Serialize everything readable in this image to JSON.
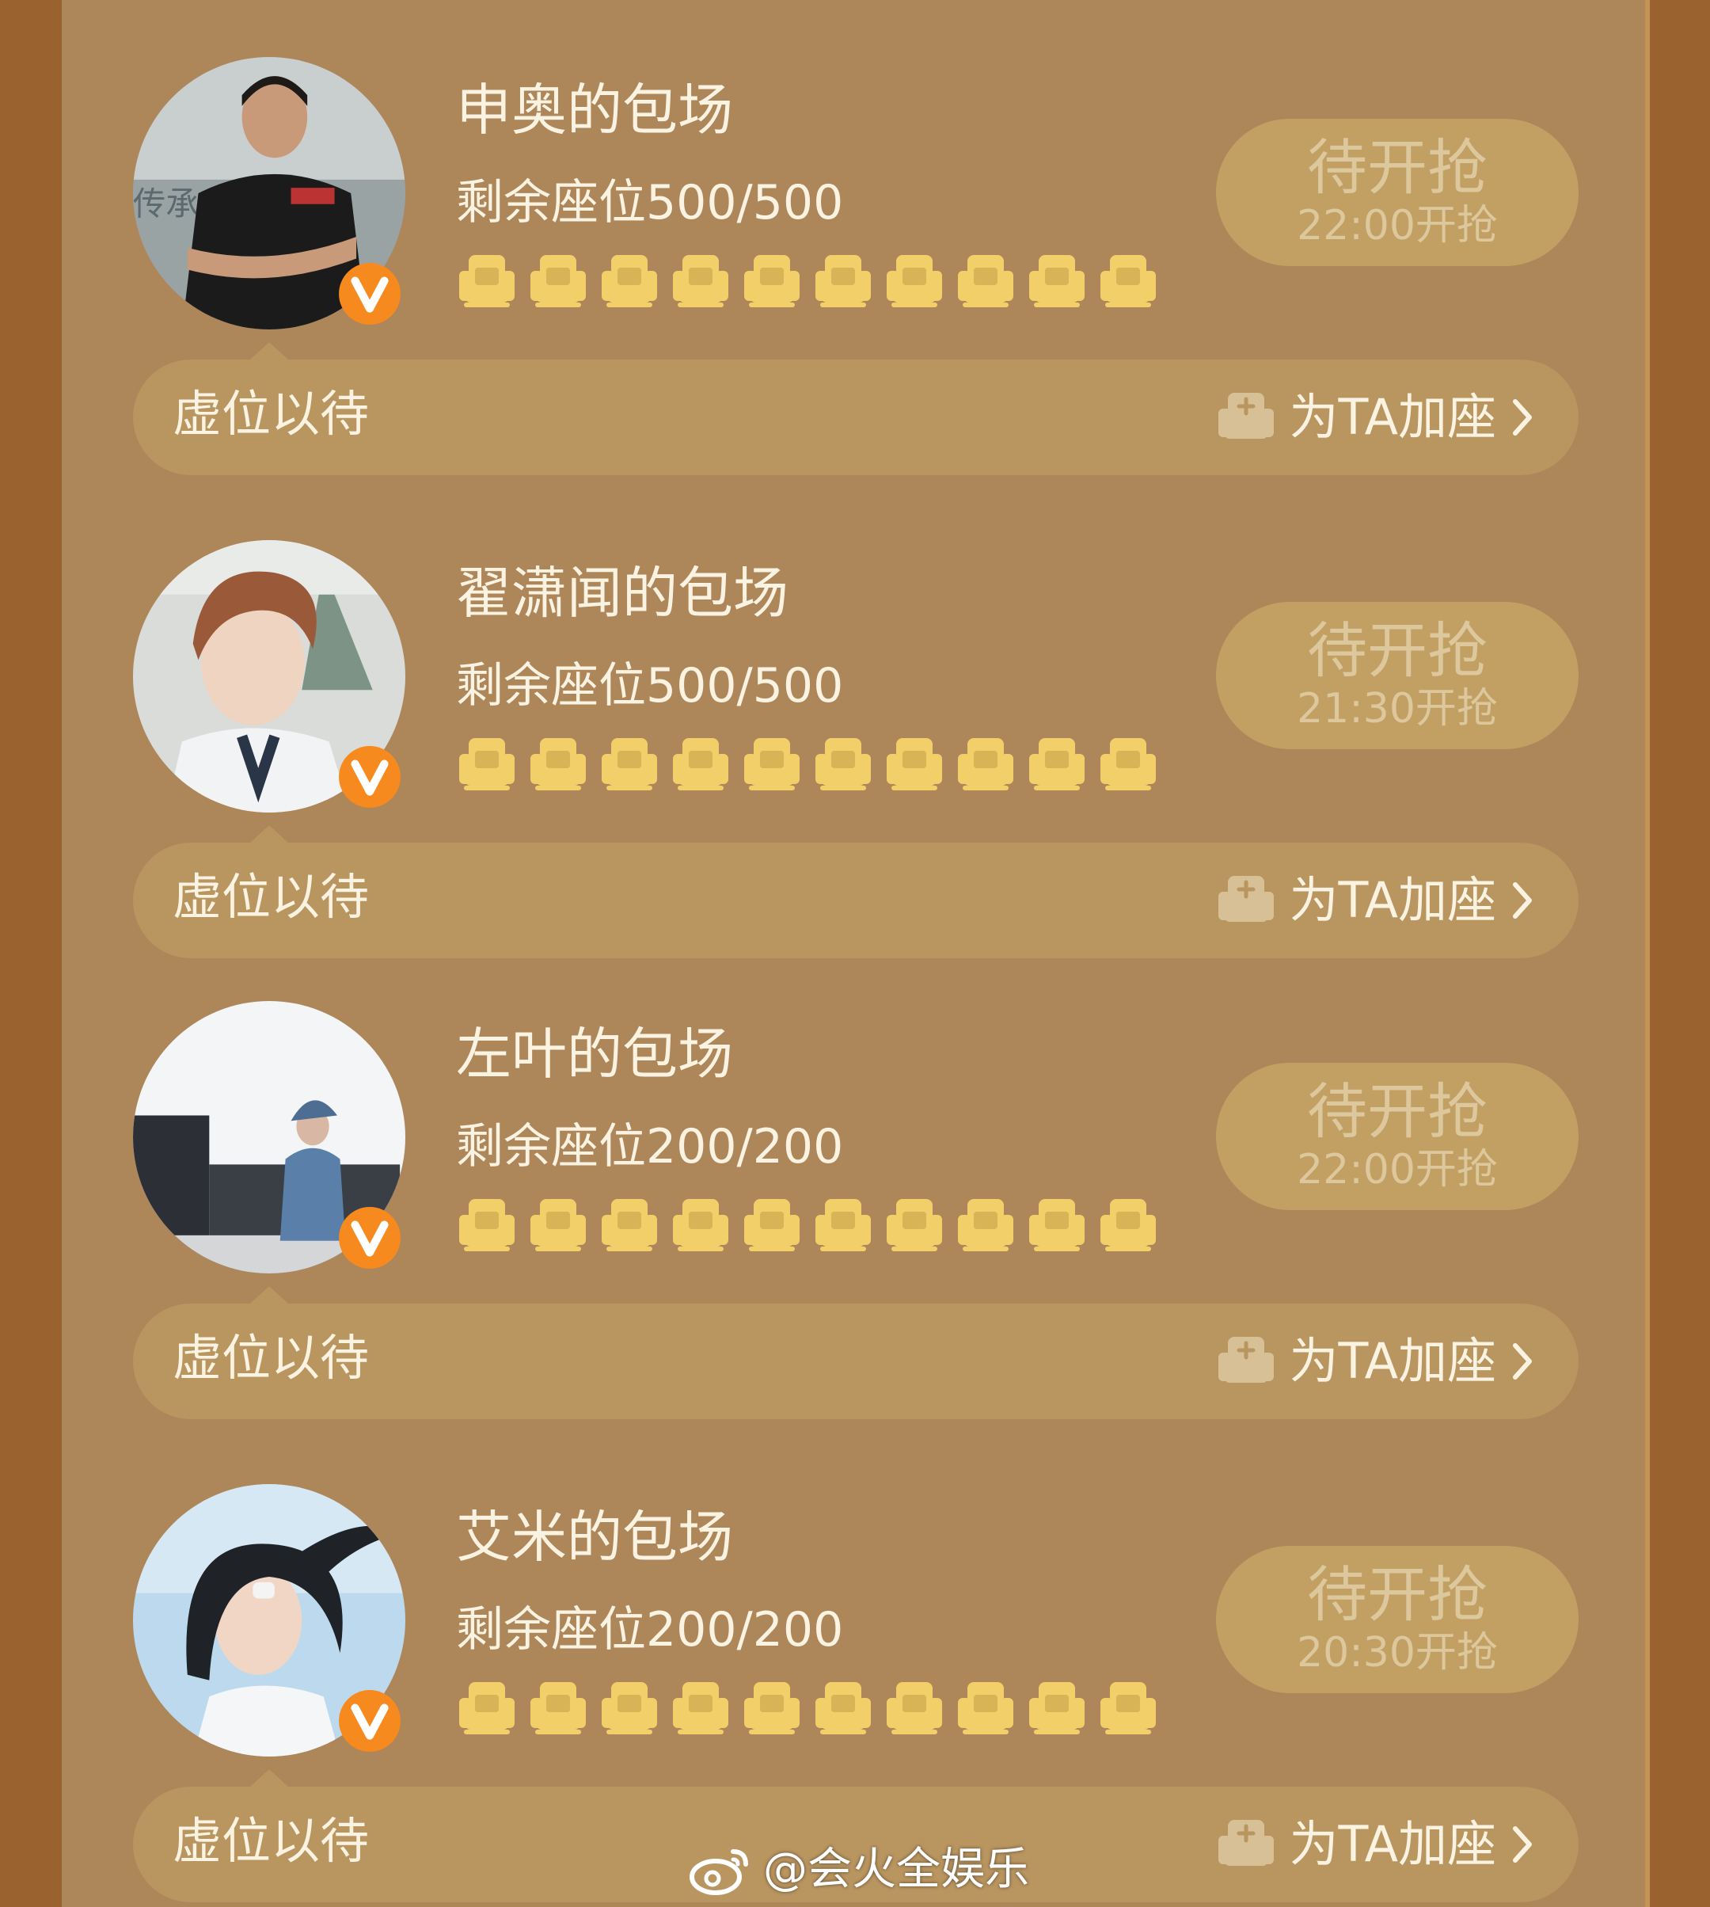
{
  "sessions": [
    {
      "title": "申奥的包场",
      "remaining": "剩余座位500/500",
      "status": "待开抢",
      "open_time": "22:00开抢",
      "note": "虚位以待",
      "add_seat": "为TA加座",
      "avatar_icon": "avatar-photo",
      "seat_count_icons": 10
    },
    {
      "title": "翟潇闻的包场",
      "remaining": "剩余座位500/500",
      "status": "待开抢",
      "open_time": "21:30开抢",
      "note": "虚位以待",
      "add_seat": "为TA加座",
      "avatar_icon": "avatar-photo",
      "seat_count_icons": 10
    },
    {
      "title": "左叶的包场",
      "remaining": "剩余座位200/200",
      "status": "待开抢",
      "open_time": "22:00开抢",
      "note": "虚位以待",
      "add_seat": "为TA加座",
      "avatar_icon": "avatar-photo",
      "seat_count_icons": 10
    },
    {
      "title": "艾米的包场",
      "remaining": "剩余座位200/200",
      "status": "待开抢",
      "open_time": "20:30开抢",
      "note": "虚位以待",
      "add_seat": "为TA加座",
      "avatar_icon": "avatar-photo",
      "seat_count_icons": 10
    }
  ],
  "watermark": "@会火全娱乐",
  "colors": {
    "page_bg": "#9a622f",
    "panel_bg": "#ad865a",
    "seat_icon": "#f3cf6a",
    "verified_badge": "#f78a1e",
    "button_bg": "#c2a063",
    "text": "#fbf3e2"
  }
}
